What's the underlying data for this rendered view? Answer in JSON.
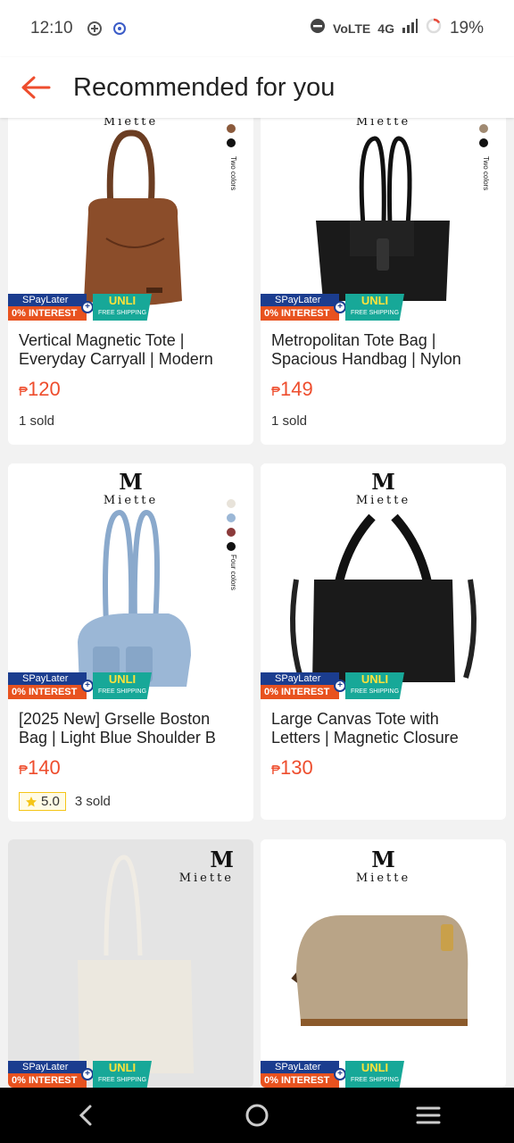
{
  "status_bar": {
    "time": "12:10",
    "network": "4G",
    "battery": "19%",
    "volte": "VoLTE"
  },
  "header": {
    "title": "Recommended for you"
  },
  "promo": {
    "spaylater": "SPayLater",
    "interest": "0% INTEREST",
    "unli": "UNLI",
    "free_shipping": "FREE SHIPPING"
  },
  "brand": {
    "name": "Miette",
    "mark": "M"
  },
  "products": [
    {
      "name": "Vertical Magnetic Tote | Everyday Carryall | Modern ...",
      "line1": "Vertical Magnetic Tote |",
      "line2": "Everyday Carryall | Modern",
      "currency": "₱",
      "price": "120",
      "sold": "1 sold",
      "colors_label": "Two colors",
      "swatches": [
        "#8b5a3c",
        "#111111"
      ]
    },
    {
      "name": "Metropolitan Tote Bag | Spacious Handbag | Nylon ...",
      "line1": "Metropolitan Tote Bag |",
      "line2": "Spacious Handbag | Nylon",
      "currency": "₱",
      "price": "149",
      "sold": "1 sold",
      "colors_label": "Two colors",
      "swatches": [
        "#a08a72",
        "#111111"
      ]
    },
    {
      "name": "[2025 New] Grselle Boston Bag | Light Blue Shoulder B...",
      "line1": "[2025 New] Grselle Boston",
      "line2": "Bag | Light Blue Shoulder B",
      "currency": "₱",
      "price": "140",
      "rating": "5.0",
      "sold": "3 sold",
      "colors_label": "Four colors",
      "swatches": [
        "#e8e3da",
        "#9bb7d6",
        "#8b3a3a",
        "#111111"
      ]
    },
    {
      "name": "Large Canvas Tote with Letters | Magnetic Closure ...",
      "line1": "Large Canvas Tote with",
      "line2": "Letters | Magnetic Closure",
      "currency": "₱",
      "price": "130",
      "sold": ""
    },
    {
      "name": "",
      "line1": "",
      "line2": ""
    },
    {
      "name": "",
      "line1": "",
      "line2": ""
    }
  ],
  "colors": {
    "accent": "#ee4d2d",
    "promo_blue": "#1b3d8f",
    "promo_teal": "#17a898"
  }
}
